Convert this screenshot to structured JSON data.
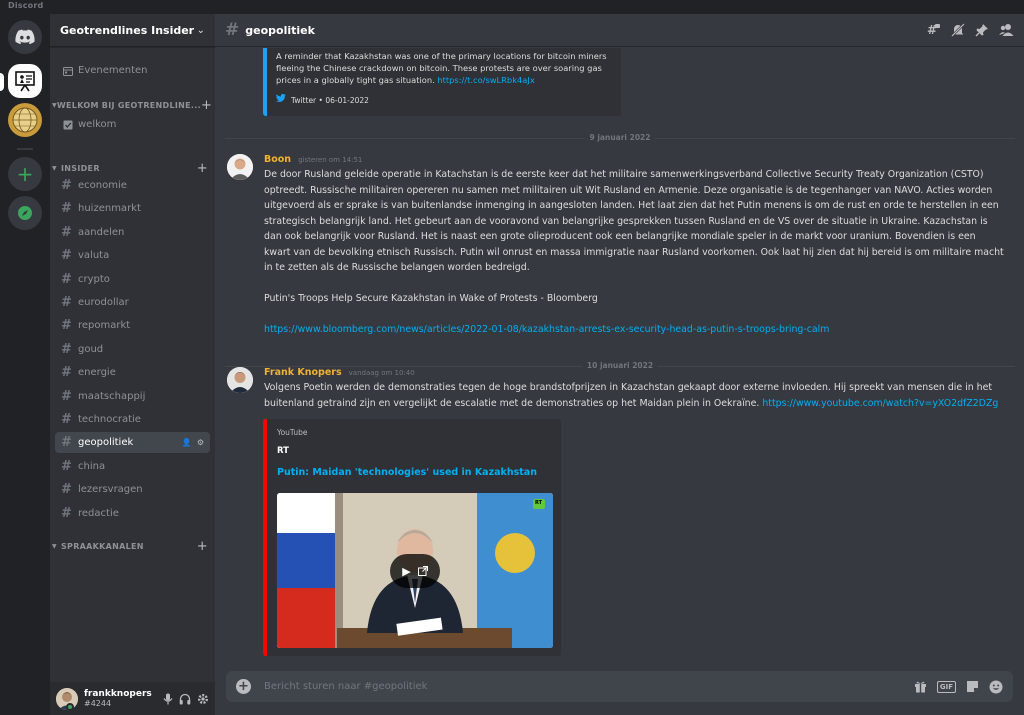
{
  "app": {
    "name": "Discord"
  },
  "servers": [
    {
      "name": "Home",
      "icon": "discord-logo-icon"
    },
    {
      "name": "Geotrendlines Insider",
      "icon": "presentation-icon"
    },
    {
      "name": "Globe server",
      "icon": "globe-icon"
    },
    {
      "name": "Add a Server",
      "icon": "plus-icon"
    },
    {
      "name": "Explore Public Servers",
      "icon": "compass-icon"
    }
  ],
  "guild": {
    "name": "Geotrendlines Insider",
    "events_label": "Evenementen",
    "categories": [
      {
        "label": "WELKOM BIJ GEOTRENDLINE...",
        "channels": [
          "welkom"
        ]
      },
      {
        "label": "INSIDER",
        "channels": [
          "economie",
          "huizenmarkt",
          "aandelen",
          "valuta",
          "crypto",
          "eurodollar",
          "repomarkt",
          "goud",
          "energie",
          "maatschappij",
          "technocratie",
          "geopolitiek",
          "china",
          "lezersvragen",
          "redactie"
        ]
      },
      {
        "label": "SPRAAKKANALEN",
        "channels": []
      }
    ],
    "active_channel": "geopolitiek"
  },
  "user": {
    "name": "frankknopers",
    "tag": "#4244"
  },
  "channel_header": {
    "name": "geopolitiek"
  },
  "tweet_embed": {
    "text": "A reminder that Kazakhstan was one of the primary locations for bitcoin miners fleeing the Chinese crackdown on bitcoin. These protests are over soaring gas prices in a globally tight gas situation.",
    "link": "https://t.co/swLRbk4aJx",
    "footer": "Twitter • 06-01-2022"
  },
  "dividers": [
    "9 januari 2022",
    "10 januari 2022"
  ],
  "messages": [
    {
      "author": "Boon",
      "timestamp": "gisteren om 14:51",
      "body": "De door Rusland geleide operatie in Katachstan is de eerste keer dat het militaire samenwerkingsverband Collective Security Treaty Organization (CSTO) optreedt. Russische militairen opereren nu samen met militairen uit Wit Rusland en Armenie. Deze organisatie is de tegenhanger van NAVO. Acties worden uitgevoerd als er sprake is van buitenlandse inmenging in aangesloten landen. Het laat zien dat het Putin menens is om de rust en orde te herstellen in een strategisch belangrijk land. Het gebeurt aan de vooravond van belangrijke gesprekken tussen Rusland en de VS over de situatie in Ukraine. Kazachstan is dan ook belangrijk voor Rusland. Het is naast een grote olieproducent ook een belangrijke mondiale speler in de markt voor uranium. Bovendien is een kwart van de bevolking etnisch Russisch. Putin wil onrust en massa immigratie naar Rusland voorkomen. Ook laat hij zien dat hij bereid is om militaire macht in te zetten als de Russische belangen worden bedreigd.",
      "quote": "Putin's Troops Help Secure Kazakhstan in Wake of Protests - Bloomberg",
      "link": "https://www.bloomberg.com/news/articles/2022-01-08/kazakhstan-arrests-ex-security-head-as-putin-s-troops-bring-calm"
    },
    {
      "author": "Frank Knopers",
      "timestamp": "vandaag om 10:40",
      "body": "Volgens Poetin werden de demonstraties tegen de hoge brandstofprijzen in Kazachstan gekaapt door externe invloeden. Hij spreekt van mensen die in het buitenland getraind zijn en vergelijkt de escalatie met de demonstraties op het Maidan plein in Oekraïne.",
      "link": "https://www.youtube.com/watch?v=yXO2dfZ2DZg",
      "embed": {
        "provider": "YouTube",
        "author": "RT",
        "title": "Putin: Maidan 'technologies' used in Kazakhstan",
        "badge": "RT"
      }
    }
  ],
  "composer": {
    "placeholder": "Bericht sturen naar #geopolitiek"
  },
  "colors": {
    "accent": "#5865f2",
    "author": "#f0b232",
    "link": "#00b0f4",
    "online": "#3ba55d"
  }
}
